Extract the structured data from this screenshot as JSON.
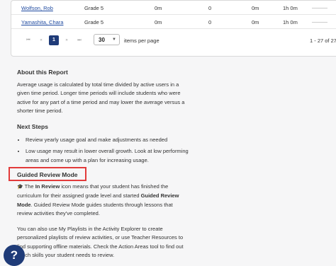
{
  "table": {
    "rows": [
      {
        "name": "Wolfson, Rob",
        "grade": "Grade 5",
        "c1": "0m",
        "c2": "0",
        "c3": "0m",
        "c4": "1h 0m"
      },
      {
        "name": "Yamashita, Chara",
        "grade": "Grade 5",
        "c1": "0m",
        "c2": "0",
        "c3": "0m",
        "c4": "1h 0m"
      }
    ]
  },
  "pager": {
    "first": "⏮",
    "prev": "«",
    "page": "1",
    "next": "»",
    "last": "⏭",
    "per_page_value": "30",
    "per_page_label": "items per page",
    "range": "1 - 27 of 27"
  },
  "about": {
    "title": "About this Report",
    "body": "Average usage is calculated by total time divided by active users in a given time period. Longer time periods will include students who were active for any part of a time period and may lower the average versus a shorter time period."
  },
  "next_steps": {
    "title": "Next Steps",
    "items": [
      "Review yearly usage goal and make adjustments as needed",
      "Low usage may result in lower overall growth. Look at low performing areas and come up with a plan for increasing usage."
    ]
  },
  "guided": {
    "title": "Guided Review Mode",
    "p1_pre": "The ",
    "p1_bold": "In Review",
    "p1_mid": " icon means that your student has finished the curriculum for their assigned grade level and started ",
    "p1_bold2": "Guided Review Mode",
    "p1_post": ". Guided Review Mode guides students through lessons that review activities they've completed.",
    "p2": "You can also use My Playlists in the Activity Explorer to create personalized playlists of review activities, or use Teacher Resources to find supporting offline materials. Check the Action Areas tool to find out which skills your student needs to review."
  },
  "help_label": "?"
}
